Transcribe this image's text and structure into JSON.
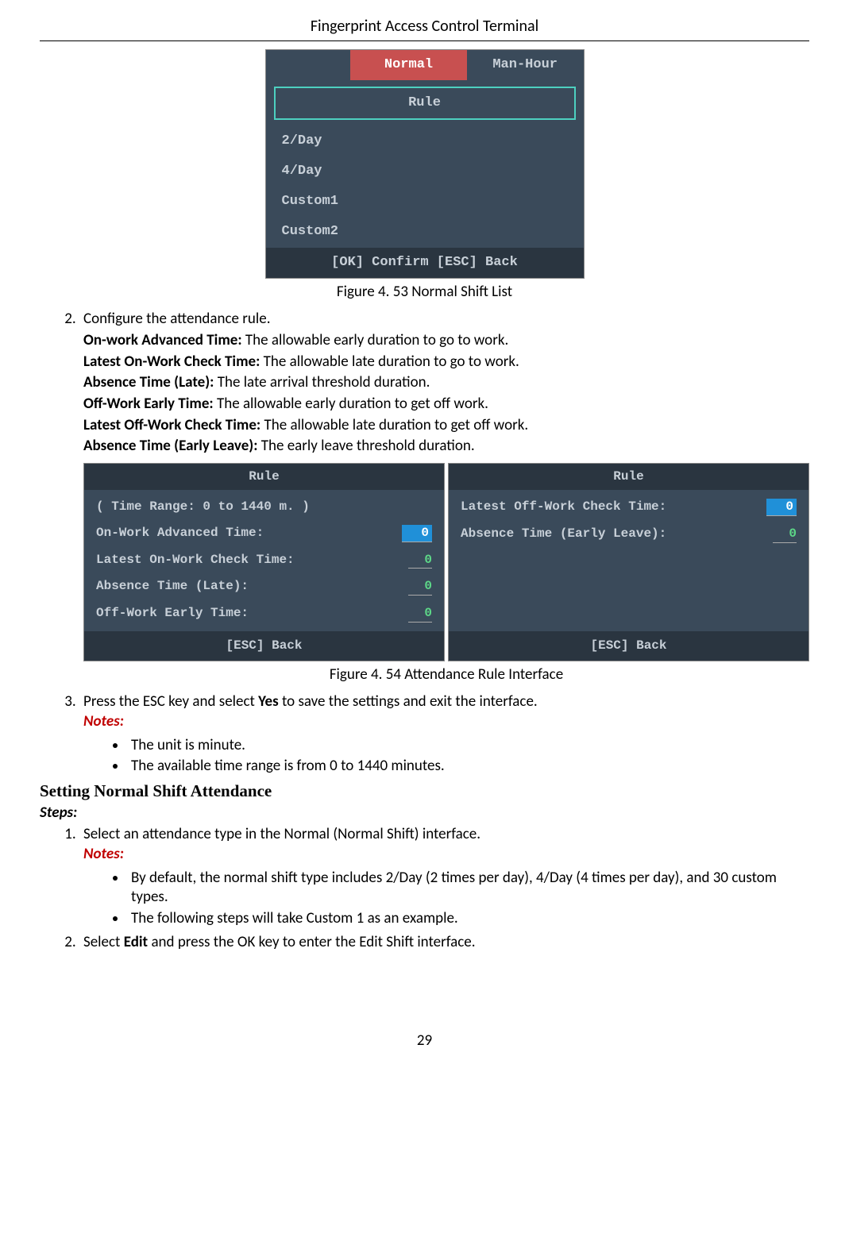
{
  "header": "Fingerprint Access Control Terminal",
  "fig53": {
    "tabs": {
      "normal": "Normal",
      "manhour": "Man-Hour"
    },
    "rule": "Rule",
    "items": [
      "2/Day",
      "4/Day",
      "Custom1",
      "Custom2"
    ],
    "footer": "[OK] Confirm   [ESC] Back",
    "caption": "Figure 4. 53 Normal Shift List"
  },
  "step2": {
    "intro": "Configure the attendance rule.",
    "defs": [
      {
        "term": "On-work Advanced Time:",
        "desc": " The allowable early duration to go to work."
      },
      {
        "term": "Latest On-Work Check Time:",
        "desc": " The allowable late duration to go to work."
      },
      {
        "term": "Absence Time (Late):",
        "desc": " The late arrival threshold duration."
      },
      {
        "term": "Off-Work Early Time:",
        "desc": " The allowable early duration to get off work."
      },
      {
        "term": "Latest Off-Work Check Time:",
        "desc": " The allowable late duration to get off work."
      },
      {
        "term": "Absence Time (Early Leave):",
        "desc": " The early leave threshold duration."
      }
    ]
  },
  "fig54": {
    "left": {
      "title": "Rule",
      "range": "( Time Range: 0 to 1440 m. )",
      "rows": [
        {
          "label": "On-Work Advanced Time:",
          "value": "0",
          "selected": true
        },
        {
          "label": "Latest On-Work Check Time:",
          "value": "0",
          "selected": false
        },
        {
          "label": "Absence Time (Late):",
          "value": "0",
          "selected": false
        },
        {
          "label": "Off-Work Early Time:",
          "value": "0",
          "selected": false
        }
      ],
      "footer": "[ESC] Back"
    },
    "right": {
      "title": "Rule",
      "rows": [
        {
          "label": "Latest Off-Work Check Time:",
          "value": "0",
          "selected": true
        },
        {
          "label": "Absence Time (Early Leave):",
          "value": "0",
          "selected": false
        }
      ],
      "footer": "[ESC] Back"
    },
    "caption": "Figure 4. 54 Attendance Rule Interface"
  },
  "step3": {
    "text_pre": "Press the ESC key and select ",
    "text_bold": "Yes",
    "text_post": " to save the settings and exit the interface.",
    "notes_label": "Notes:",
    "notes": [
      "The unit is minute.",
      "The available time range is from 0 to 1440 minutes."
    ]
  },
  "subsection": "Setting Normal Shift Attendance",
  "steps_label": "Steps:",
  "shift_steps": {
    "s1": {
      "text": "Select an attendance type in the Normal (Normal Shift) interface.",
      "notes_label": "Notes:",
      "notes": [
        "By default, the normal shift type includes 2/Day (2 times per day), 4/Day (4 times per day), and 30 custom types.",
        "The following steps will take Custom 1 as an example."
      ]
    },
    "s2": {
      "pre": "Select ",
      "bold": "Edit",
      "post": " and press the OK key to enter the Edit Shift interface."
    }
  },
  "page_number": "29"
}
